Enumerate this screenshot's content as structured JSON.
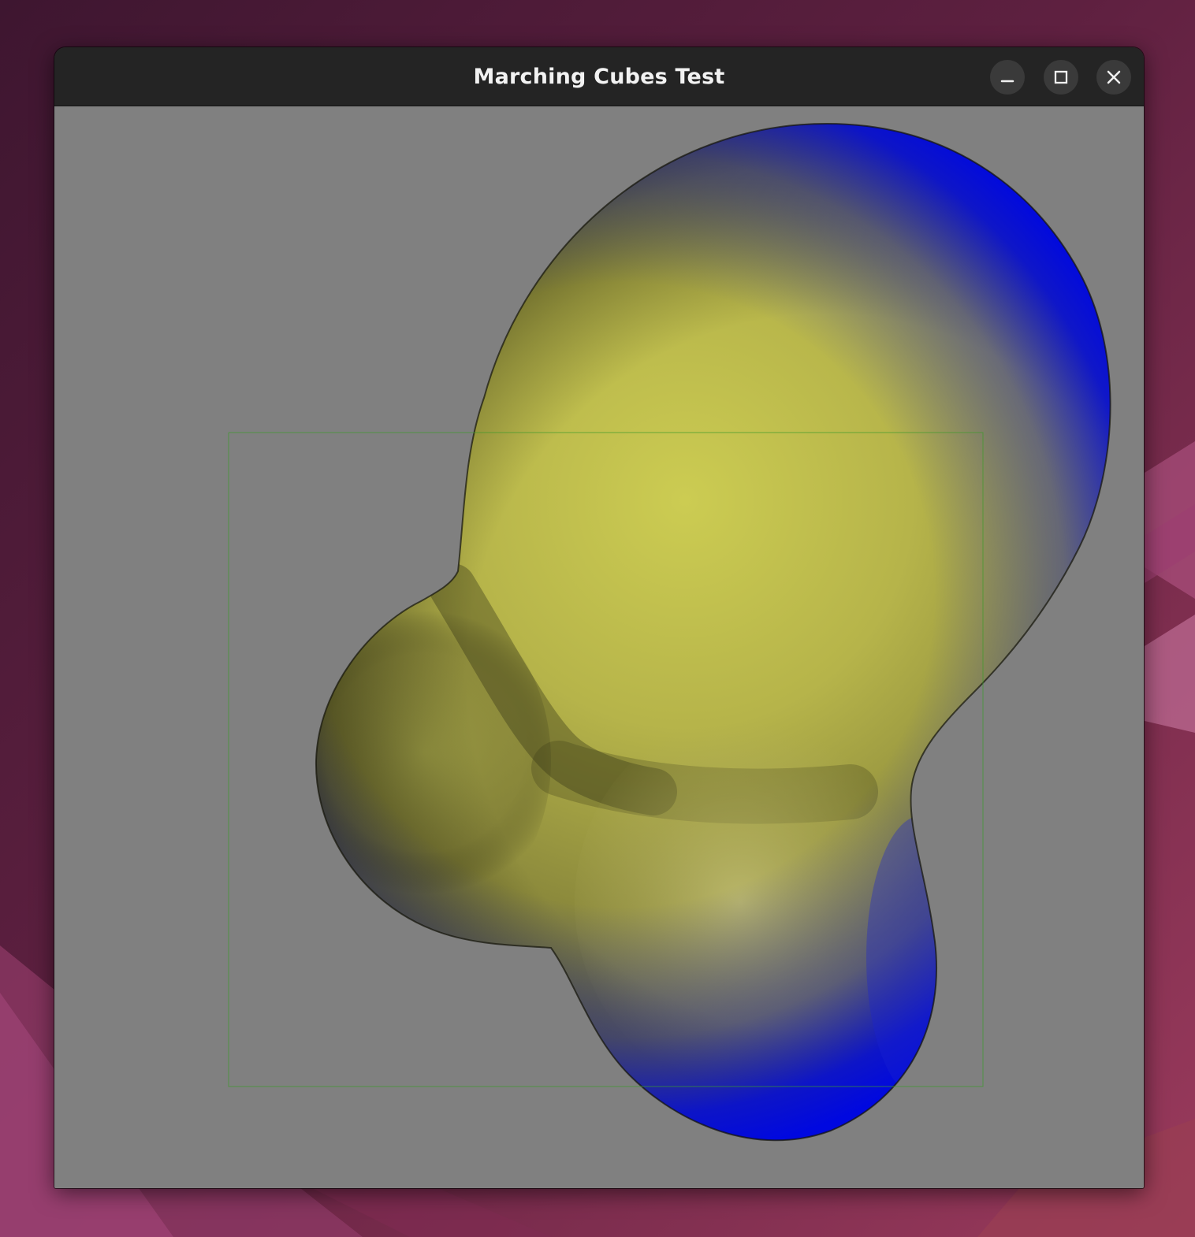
{
  "window": {
    "title": "Marching Cubes Test"
  },
  "titlebar_buttons": [
    {
      "name": "minimize",
      "icon": "minimize-icon"
    },
    {
      "name": "maximize",
      "icon": "maximize-icon"
    },
    {
      "name": "close",
      "icon": "close-icon"
    }
  ],
  "scene": {
    "background_color": "#808080",
    "surface_colors": {
      "lit": "#cccc55",
      "mid": "#9a9a45",
      "shadow": "#2a2a14",
      "rim": "#0a10d8"
    },
    "bounding_box_color": "#3c9a2a"
  },
  "desktop": {
    "wallpaper_colors": [
      "#4a1a32",
      "#6b2446",
      "#8a3458",
      "#a03a5e"
    ]
  }
}
